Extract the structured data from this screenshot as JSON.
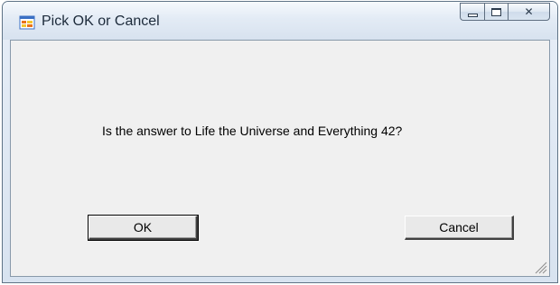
{
  "window": {
    "title": "Pick OK or Cancel",
    "icon": "app-window-icon",
    "controls": {
      "minimize": "minimize-icon",
      "maximize": "maximize-icon",
      "close": "close-icon",
      "close_glyph": "✕"
    }
  },
  "dialog": {
    "message": "Is the answer to Life the Universe and Everything 42?",
    "ok_label": "OK",
    "cancel_label": "Cancel"
  },
  "colors": {
    "client_background": "#f0f0f0",
    "titlebar_background": "#dce6f2",
    "icon_orange": "#e8731a",
    "icon_yellow": "#f4c52e",
    "icon_blue": "#3a6fc4"
  }
}
